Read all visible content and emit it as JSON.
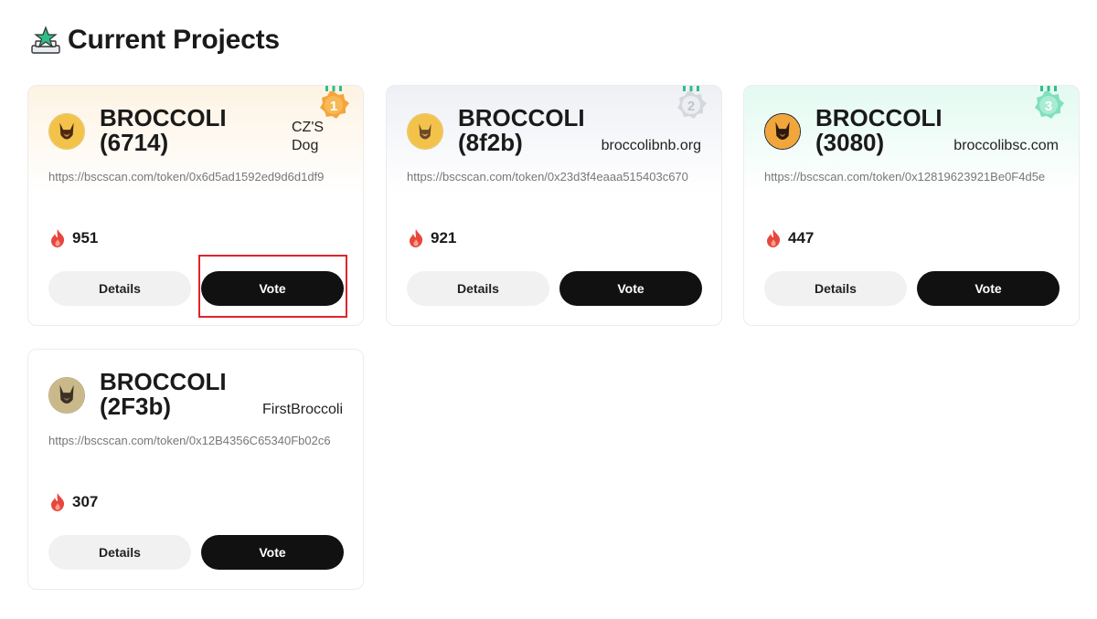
{
  "page": {
    "title": "Current Projects",
    "header_icon": "podium-icon"
  },
  "projects": [
    {
      "name": "BROCCOLI (6714)",
      "website": "CZ'S Dog",
      "url": "https://bscscan.com/token/0x6d5ad1592ed9d6d1df9",
      "votes": "951",
      "rank": "1",
      "details_label": "Details",
      "vote_label": "Vote"
    },
    {
      "name": "BROCCOLI (8f2b)",
      "website": "broccolibnb.org",
      "url": "https://bscscan.com/token/0x23d3f4eaaa515403c670",
      "votes": "921",
      "rank": "2",
      "details_label": "Details",
      "vote_label": "Vote"
    },
    {
      "name": "BROCCOLI (3080)",
      "website": "broccolibsc.com",
      "url": "https://bscscan.com/token/0x12819623921Be0F4d5e",
      "votes": "447",
      "rank": "3",
      "details_label": "Details",
      "vote_label": "Vote"
    },
    {
      "name": "BROCCOLI (2F3b)",
      "website": "FirstBroccoli",
      "url": "https://bscscan.com/token/0x12B4356C65340Fb02c6",
      "votes": "307",
      "details_label": "Details",
      "vote_label": "Vote"
    }
  ],
  "colors": {
    "gold_medal": "#f5a53a",
    "silver_medal": "#d4d7dc",
    "green_medal": "#7fe0bd",
    "flame": "#e8473d",
    "highlight": "#e0242a"
  }
}
